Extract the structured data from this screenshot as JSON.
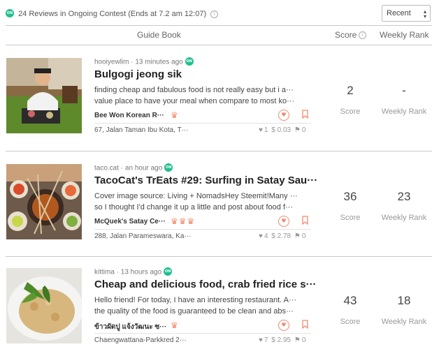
{
  "topbar": {
    "on_badge": "ON",
    "contest_text": "24 Reviews in Ongoing Contest (Ends at 7.2 am 12:07)",
    "info_icon": "i",
    "sort_value": "Recent"
  },
  "header": {
    "guide_book": "Guide Book",
    "score": "Score",
    "weekly_rank": "Weekly Rank"
  },
  "reviews": [
    {
      "author": "hooiyewlim",
      "time": "13 minutes ago",
      "on_badge": "ON",
      "title": "Bulgogi jeong sik",
      "excerpt1": "finding cheap and fabulous food is not really easy but i a···",
      "excerpt2": "value place to have your meal when compare to most ko···",
      "tag": "Bee Won Korean R···",
      "crowns": "♛",
      "address": "67, Jalan Taman Ibu Kota, T···",
      "likes": "1",
      "payout": "$ 0.03",
      "flags": "0",
      "score": "2",
      "score_label": "Score",
      "rank": "-",
      "rank_label": "Weekly Rank"
    },
    {
      "author": "taco.cat",
      "time": "an hour ago",
      "on_badge": "ON",
      "title": "TacoCat's TrEats #29: Surfing in Satay Sau···",
      "excerpt1": "Cover image source: Living + NomadsHey Steemit!Many ···",
      "excerpt2": "so I thought I'd change it up a little and post about food f···",
      "tag": "McQuek's Satay Ce···",
      "crowns": "♛♛♛",
      "address": "288, Jalan Parameswara, Ka···",
      "likes": "4",
      "payout": "$ 2.78",
      "flags": "0",
      "score": "36",
      "score_label": "Score",
      "rank": "23",
      "rank_label": "Weekly Rank"
    },
    {
      "author": "kittima",
      "time": "13 hours ago",
      "on_badge": "ON",
      "title": "Cheap and delicious food, crab fried rice s···",
      "excerpt1": "Hello friend! For today, I have an interesting restaurant. A···",
      "excerpt2": "the quality of the food is guaranteed to be clean and abs···",
      "tag": "ข้าวผัดปู แจ้งวัฒนะ ซ···",
      "crowns": "♛",
      "address": "Chaengwattana-Parkkred 2···",
      "likes": "7",
      "payout": "$ 2.95",
      "flags": "0",
      "score": "43",
      "score_label": "Score",
      "rank": "18",
      "rank_label": "Weekly Rank"
    }
  ],
  "colors": {
    "accent_green": "#1fbf8f",
    "accent_coral": "#f08a6c"
  }
}
